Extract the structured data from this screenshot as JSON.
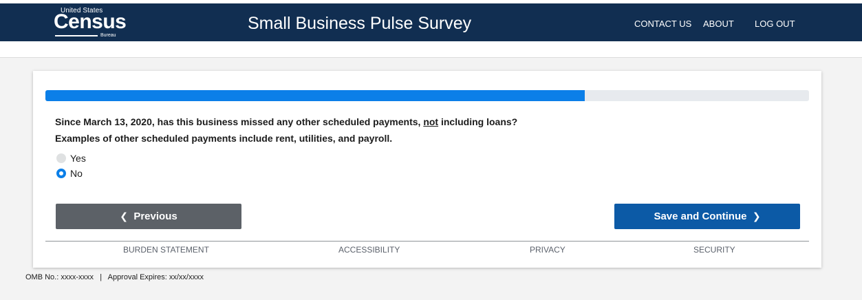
{
  "header": {
    "logo": {
      "line1": "United States",
      "line2": "Census",
      "line3": "Bureau"
    },
    "title": "Small Business Pulse Survey",
    "nav": [
      "CONTACT US",
      "ABOUT",
      "LOG OUT"
    ],
    "colors": {
      "bar": "#112e51"
    }
  },
  "progress": {
    "fraction": 0.706,
    "color": "#0b7fe8"
  },
  "question": {
    "line1_before": "Since March 13, 2020, has this business missed any other scheduled payments, ",
    "line1_underlined": "not",
    "line1_after": " including loans?",
    "line2": "Examples of other scheduled payments include rent, utilities, and payroll."
  },
  "options": [
    {
      "label": "Yes",
      "selected": false
    },
    {
      "label": "No",
      "selected": true
    }
  ],
  "buttons": {
    "previous": {
      "label": "Previous",
      "icon": "chevron-left-icon"
    },
    "next": {
      "label": "Save and Continue",
      "icon": "chevron-right-icon"
    }
  },
  "footer_links": [
    "BURDEN STATEMENT",
    "ACCESSIBILITY",
    "PRIVACY",
    "SECURITY"
  ],
  "omb": {
    "number": "OMB No.: xxxx-xxxx",
    "separator": "|",
    "expires": "Approval Expires: xx/xx/xxxx"
  }
}
